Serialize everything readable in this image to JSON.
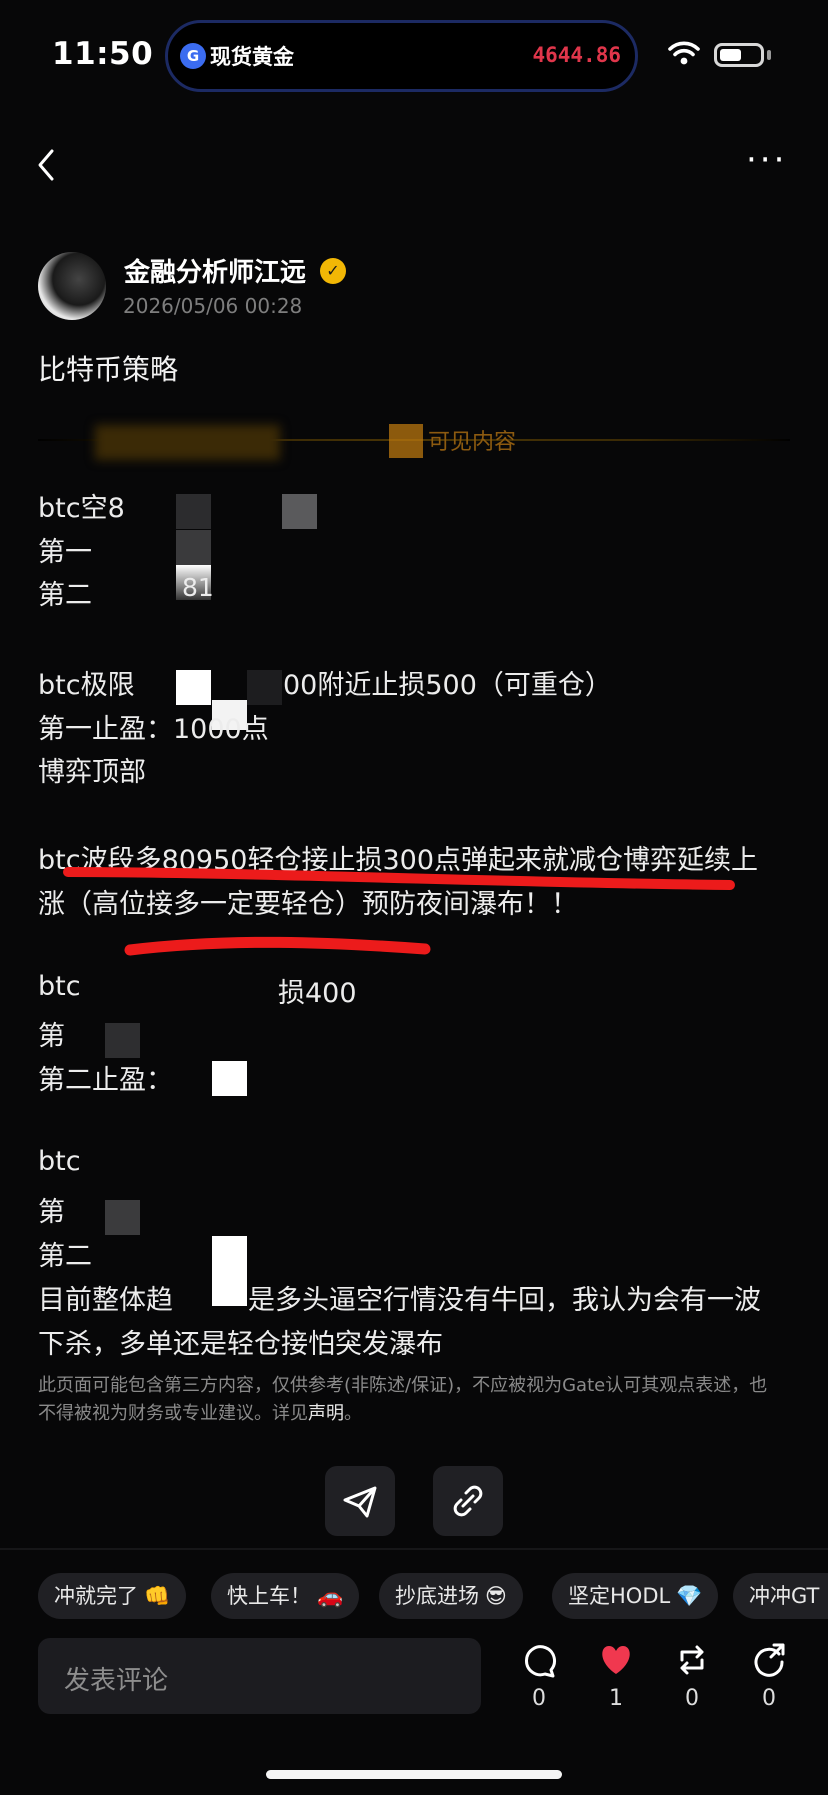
{
  "status_bar": {
    "time": "11:50"
  },
  "island": {
    "label": "现货黄金",
    "price": "4644.86"
  },
  "post": {
    "author": "金融分析师江远",
    "date": "2026/05/06 00:28",
    "title": "比特币策略",
    "paywall_text": "可见内容",
    "lines": [
      "btc空8",
      "第一",
      "第二",
      "81",
      "btc极限",
      "00附近止损500（可重仓）",
      "第一止盈：1000点",
      "博弈顶部",
      "btc波段多80950轻仓接止损300点弹起来就减仓博弈延续上",
      "涨（高位接多一定要轻仓）预防夜间瀑布！！",
      "btc",
      "损400",
      "第",
      "第二止盈：",
      "btc",
      "第",
      "第二",
      "目前整体趋",
      "是多头逼空行情没有牛回，我认为会有一波",
      "下杀，多单还是轻仓接怕突发瀑布"
    ],
    "disclaimer": "此页面可能包含第三方内容，仅供参考(非陈述/保证)，不应被视为Gate认可其观点表述，也不得被视为财务或专业建议。详见",
    "disclaimer_link": "声明",
    "disclaimer_end": "。"
  },
  "reactions": [
    {
      "label": "冲就完了",
      "emoji": "👊"
    },
    {
      "label": "快上车！",
      "emoji": "🚗"
    },
    {
      "label": "抄底进场",
      "emoji": "😎"
    },
    {
      "label": "坚定HODL",
      "emoji": "💎"
    },
    {
      "label": "冲冲GT",
      "emoji": ""
    }
  ],
  "comment": {
    "placeholder": "发表评论"
  },
  "actions": {
    "comments": "0",
    "likes": "1",
    "reposts": "0",
    "shares": "0"
  },
  "colors": {
    "accent_red": "#e0364b",
    "highlight_red": "#ec1b1b",
    "verified_gold": "#f2b705",
    "like_red": "#f0384f"
  }
}
